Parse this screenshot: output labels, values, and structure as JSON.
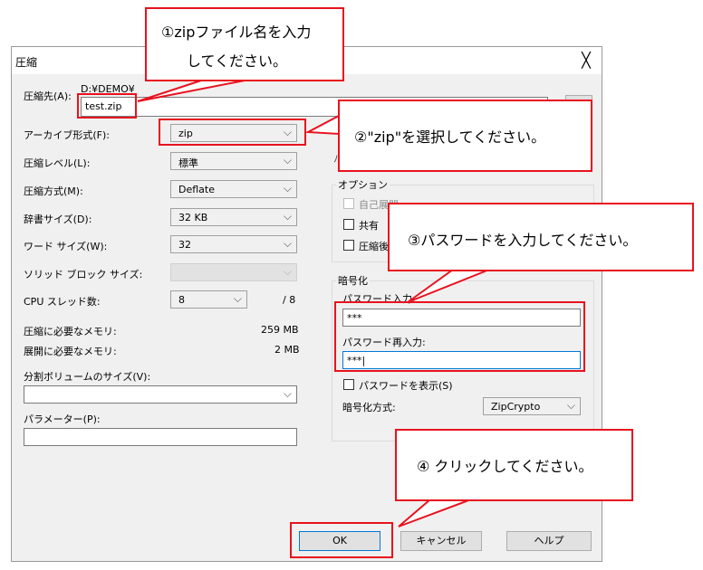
{
  "dialog": {
    "title": "圧縮",
    "close_glyph": "╳",
    "dest_label": "圧縮先(A):",
    "dest_path": "D:¥DEMO¥",
    "dest_value": "test.zip",
    "archive_format": {
      "label": "アーカイブ形式(F):",
      "value": "zip"
    },
    "compression_level": {
      "label": "圧縮レベル(L):",
      "value": "標準"
    },
    "compression_method": {
      "label": "圧縮方式(M):",
      "value": "Deflate"
    },
    "dictionary_size": {
      "label": "辞書サイズ(D):",
      "value": "32 KB"
    },
    "word_size": {
      "label": "ワード サイズ(W):",
      "value": "32"
    },
    "solid_block": {
      "label": "ソリッド ブロック サイズ:",
      "value": ""
    },
    "cpu_threads": {
      "label": "CPU スレッド数:",
      "value": "8",
      "max": "/ 8"
    },
    "memory_compress": {
      "label": "圧縮に必要なメモリ:",
      "value": "259 MB"
    },
    "memory_decompress": {
      "label": "展開に必要なメモリ:",
      "value": "2 MB"
    },
    "split_volume": {
      "label": "分割ボリュームのサイズ(V):",
      "value": ""
    },
    "parameters": {
      "label": "パラメーター(P):",
      "value": ""
    },
    "options": {
      "title": "オプション",
      "item1": "自己展開",
      "item2": "共有",
      "item3": "圧縮後"
    },
    "encryption": {
      "title": "暗号化",
      "password_label": "パスワード入力:",
      "password_value": "***",
      "reenter_label": "パスワード再入力:",
      "reenter_value": "***|",
      "show_password": "パスワードを表示(S)",
      "method_label": "暗号化方式:",
      "method_value": "ZipCrypto"
    },
    "buttons": {
      "ok": "OK",
      "cancel": "キャンセル",
      "help": "ヘルプ"
    }
  },
  "annotations": {
    "step1_line1": "①zipファイル名を入力",
    "step1_line2": "してください。",
    "step2": "②\"zip\"を選択してください。",
    "step3": "③パスワードを入力してください。",
    "step4": "④ クリックしてください。",
    "accent_color": "#e8121e"
  }
}
